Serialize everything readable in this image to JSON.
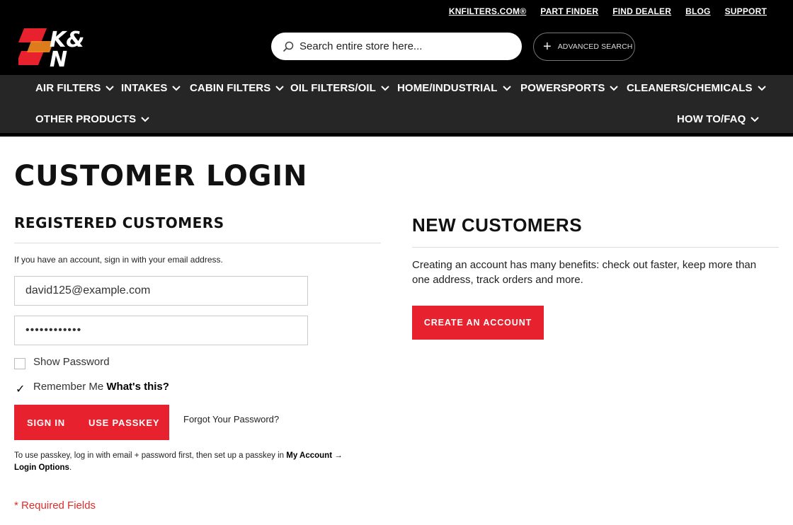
{
  "toplinks": [
    "KNFILTERS.COM®",
    "PART FINDER",
    "FIND DEALER",
    "BLOG",
    "SUPPORT"
  ],
  "search": {
    "placeholder": "Search entire store here..."
  },
  "advanced_search": "ADVANCED SEARCH",
  "nav": {
    "air_filters": "AIR FILTERS",
    "intakes": "INTAKES",
    "cabin_filters": "CABIN FILTERS",
    "oil_filters": "OIL FILTERS/OIL",
    "home_industrial": "HOME/INDUSTRIAL",
    "powersports": "POWERSPORTS",
    "cleaners": "CLEANERS/CHEMICALS",
    "other_products": "OTHER PRODUCTS",
    "howto": "HOW TO/FAQ"
  },
  "page_title": "CUSTOMER LOGIN",
  "registered": {
    "title": "REGISTERED CUSTOMERS",
    "intro": "If you have an account, sign in with your email address.",
    "email_value": "david125@example.com",
    "password_value": "••••••••••••",
    "show_password": "Show Password",
    "remember_me": "Remember Me",
    "whats_this": "What's this?",
    "sign_in": "SIGN IN",
    "use_passkey": "USE PASSKEY",
    "forgot": "Forgot Your Password?",
    "note_prefix": "To use passkey, log in with email + password first, then set up a passkey in ",
    "note_my_account": "My Account →",
    "note_login_options": "Login Options",
    "note_suffix": ".",
    "required": "* Required Fields"
  },
  "new_customers": {
    "title": "NEW CUSTOMERS",
    "text": "Creating an account has many benefits: check out faster, keep more than one address, track orders and more.",
    "create_button": "CREATE AN ACCOUNT"
  },
  "colors": {
    "accent": "#e8212e",
    "header_bg": "#000000",
    "nav_bg": "#262626"
  }
}
